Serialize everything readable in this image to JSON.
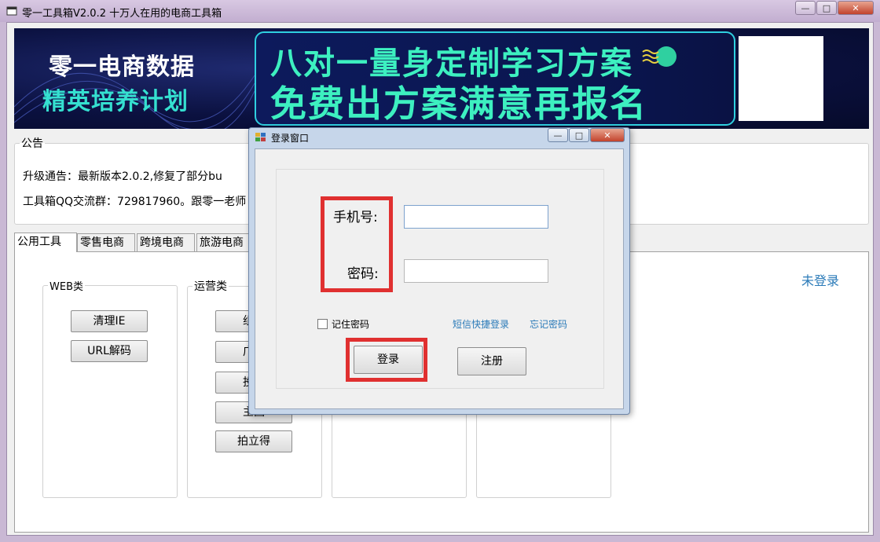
{
  "window": {
    "title": "零一工具箱V2.0.2 十万人在用的电商工具箱",
    "controls": {
      "minimize": "—",
      "maximize": "□",
      "close": "✕"
    }
  },
  "banner": {
    "left_line1": "零一电商数据",
    "left_line2": "精英培养计划",
    "main_line1": "八对一量身定制学习方案",
    "main_line2": "免费出方案满意再报名"
  },
  "notice": {
    "legend": "公告",
    "line1": "升级通告：最新版本2.0.2,修复了部分bu",
    "line2": "工具箱QQ交流群：729817960。跟零一老师"
  },
  "tabs": [
    "公用工具",
    "零售电商",
    "跨境电商",
    "旅游电商"
  ],
  "groups": {
    "web": {
      "legend": "WEB类",
      "buttons": [
        "清理IE",
        "URL解码"
      ]
    },
    "ops": {
      "legend": "运营类",
      "buttons": [
        "组合",
        "广告",
        "投产",
        "主图",
        "拍立得"
      ]
    }
  },
  "status": {
    "login_state": "未登录"
  },
  "login_dialog": {
    "title": "登录窗口",
    "phone_label": "手机号:",
    "password_label": "密码:",
    "remember_label": "记住密码",
    "remember_checked": false,
    "sms_login_link": "短信快捷登录",
    "forgot_link": "忘记密码",
    "login_button": "登录",
    "register_button": "注册",
    "highlight_color": "#e03030"
  }
}
